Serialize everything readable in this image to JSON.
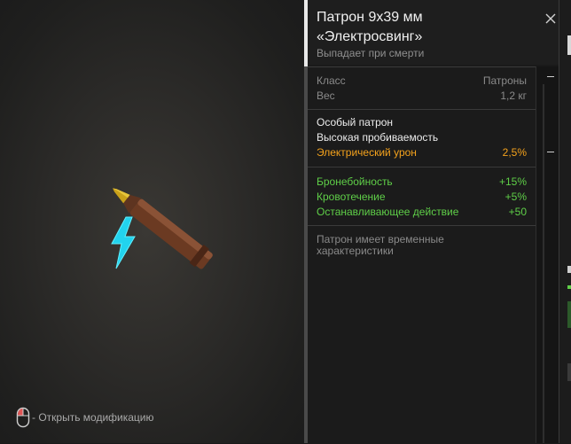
{
  "header": {
    "title": "Патрон 9х39 мм\n«Электросвинг»",
    "subtitle": "Выпадает при смерти"
  },
  "icons": {
    "close": "close-icon",
    "mouse": "mouse-left-click-icon",
    "item": "rifle-cartridge-icon",
    "effect": "lightning-bolt-icon"
  },
  "info": {
    "class_label": "Класс",
    "class_value": "Патроны",
    "weight_label": "Вес",
    "weight_value": "1,2 кг"
  },
  "special": {
    "line1": "Особый патрон",
    "line2": "Высокая пробиваемость",
    "electric_label": "Электрический урон",
    "electric_value": "2,5%"
  },
  "stats": [
    {
      "label": "Бронебойность",
      "value": "+15%"
    },
    {
      "label": "Кровотечение",
      "value": "+5%"
    },
    {
      "label": "Останавливающее действие",
      "value": "+50"
    }
  ],
  "note": "Патрон имеет временные\nхарактеристики",
  "hint": "- Открыть модификацию",
  "colors": {
    "accent_orange": "#f4a21c",
    "positive_green": "#5fcf48",
    "bolt_cyan": "#22d3ee"
  }
}
